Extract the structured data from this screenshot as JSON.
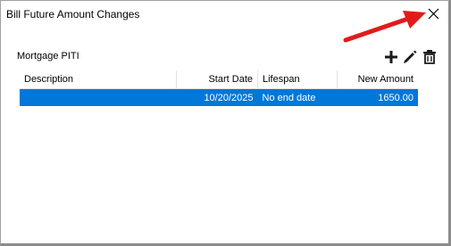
{
  "window": {
    "title": "Bill Future Amount Changes"
  },
  "bill": {
    "name": "Mortgage PITI"
  },
  "toolbar": {
    "add_icon": "plus-icon",
    "edit_icon": "pencil-icon",
    "delete_icon": "trash-icon"
  },
  "table": {
    "columns": [
      "Description",
      "Start Date",
      "Lifespan",
      "New Amount"
    ],
    "rows": [
      {
        "description": "",
        "start_date": "10/20/2025",
        "lifespan": "No end date",
        "new_amount": "1650.00"
      }
    ]
  },
  "colors": {
    "selection": "#0078d7",
    "annotation_arrow": "#e11b1b"
  }
}
